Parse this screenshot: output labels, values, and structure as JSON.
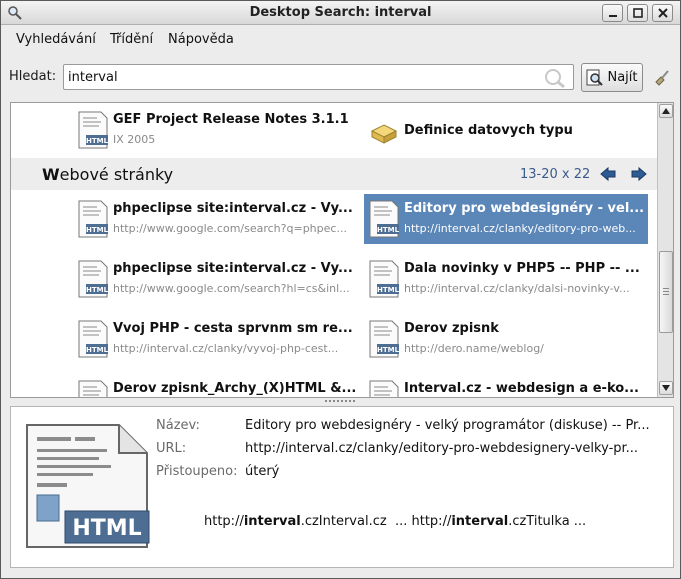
{
  "window": {
    "title": "Desktop Search: interval"
  },
  "menubar": {
    "items": [
      "Vyhledávání",
      "Třídění",
      "Nápověda"
    ]
  },
  "search": {
    "label": "Hledat:",
    "value": "interval",
    "find_label": "Najít"
  },
  "results": {
    "top_row": [
      {
        "title": "GEF Project Release Notes 3.1.1",
        "subtitle": "IX 2005",
        "icon": "html-document-icon"
      },
      {
        "title": "Definice datovych typu",
        "subtitle": "",
        "icon": "package-icon"
      }
    ],
    "group": {
      "title": "Webové stránky",
      "count": "13-20 x 22"
    },
    "items": [
      {
        "title": "phpeclipse site:interval.cz - Vy...",
        "url": "http://www.google.com/search?q=phpec...",
        "selected": false
      },
      {
        "title": "Editory pro webdesignéry - vel...",
        "url": "http://interval.cz/clanky/editory-pro-web...",
        "selected": true
      },
      {
        "title": "phpeclipse site:interval.cz - Vy...",
        "url": "http://www.google.com/search?hl=cs&inl...",
        "selected": false
      },
      {
        "title": "Dala novinky v PHP5 -- PHP -- ...",
        "url": "http://interval.cz/clanky/dalsi-novinky-v...",
        "selected": false
      },
      {
        "title": "Vvoj PHP - cesta sprvnm sm re...",
        "url": "http://interval.cz/clanky/vyvoj-php-cest...",
        "selected": false
      },
      {
        "title": "Derov zpisnk",
        "url": "http://dero.name/weblog/",
        "selected": false
      },
      {
        "title": "Derov zpisnk_Archy_(X)HTML &...",
        "url": "",
        "selected": false
      },
      {
        "title": "Interval.cz - webdesign a e-ko...",
        "url": "",
        "selected": false
      }
    ]
  },
  "details": {
    "name_label": "Název:",
    "name_value": "Editory pro webdesignéry - velký programátor (diskuse) -- Pr...",
    "url_label": "URL:",
    "url_value": "http://interval.cz/clanky/editory-pro-webdesignery-velky-pr...",
    "accessed_label": "Přistoupeno:",
    "accessed_value": "úterý",
    "snippet": {
      "part1_prefix": "http://",
      "part1_bold": "interval",
      "part1_rest": ".czInterval.cz",
      "ellipsis": "...",
      "part2_prefix": "http://",
      "part2_bold": "interval",
      "part2_rest": ".czTitulka ..."
    },
    "icon_label": "HTML"
  },
  "colors": {
    "selection": "#5b86b8",
    "accent_text": "#3a5a8c"
  }
}
